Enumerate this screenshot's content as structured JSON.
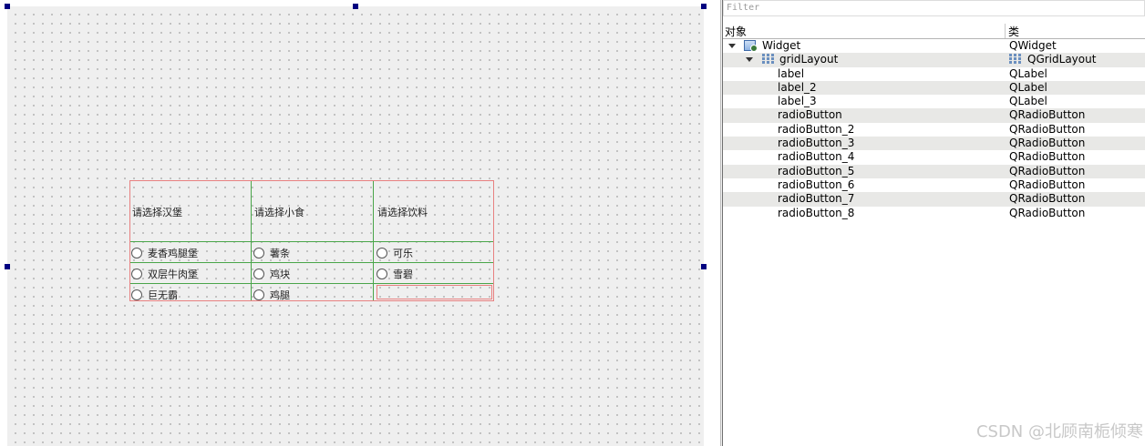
{
  "canvas": {
    "grid_labels": [
      "请选择汉堡",
      "请选择小食",
      "请选择饮料"
    ],
    "radio_columns": [
      [
        "麦香鸡腿堡",
        "双层牛肉堡",
        "巨无霸"
      ],
      [
        "薯条",
        "鸡块",
        "鸡腿"
      ],
      [
        "可乐",
        "雪碧"
      ]
    ]
  },
  "inspector": {
    "filter_placeholder": "Filter",
    "columns": {
      "object": "对象",
      "class": "类"
    },
    "tree": [
      {
        "object": "Widget",
        "class": "QWidget",
        "icon": "widget-icon",
        "expanded": true
      },
      {
        "object": "gridLayout",
        "class": "QGridLayout",
        "icon": "grid-layout-icon",
        "expanded": true
      },
      {
        "object": "label",
        "class": "QLabel"
      },
      {
        "object": "label_2",
        "class": "QLabel"
      },
      {
        "object": "label_3",
        "class": "QLabel"
      },
      {
        "object": "radioButton",
        "class": "QRadioButton"
      },
      {
        "object": "radioButton_2",
        "class": "QRadioButton"
      },
      {
        "object": "radioButton_3",
        "class": "QRadioButton"
      },
      {
        "object": "radioButton_4",
        "class": "QRadioButton"
      },
      {
        "object": "radioButton_5",
        "class": "QRadioButton"
      },
      {
        "object": "radioButton_6",
        "class": "QRadioButton"
      },
      {
        "object": "radioButton_7",
        "class": "QRadioButton"
      },
      {
        "object": "radioButton_8",
        "class": "QRadioButton"
      }
    ]
  },
  "watermark": "CSDN @北顾南栀倾寒"
}
